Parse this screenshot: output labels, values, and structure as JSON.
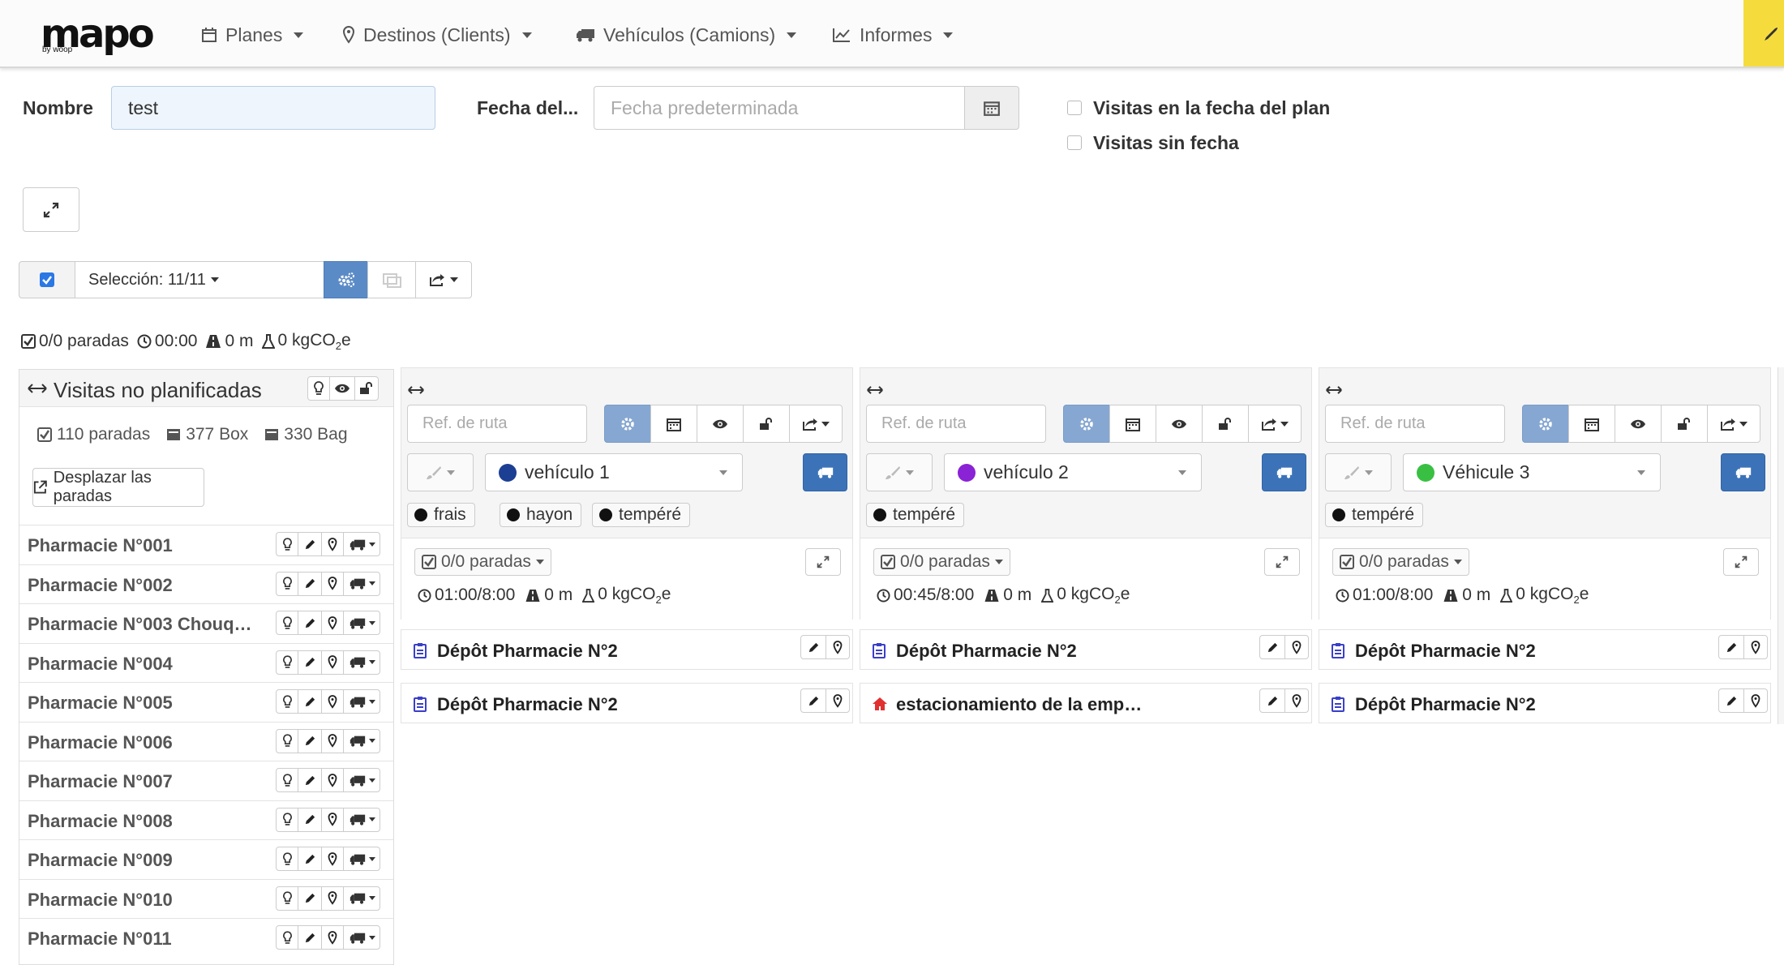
{
  "brand": {
    "name": "mapo",
    "tagline": "by woop"
  },
  "nav": {
    "planes": "Planes",
    "destinos": "Destinos (Clients)",
    "vehiculos": "Vehículos (Camions)",
    "informes": "Informes"
  },
  "form": {
    "nombre_label": "Nombre",
    "nombre_value": "test",
    "fecha_label": "Fecha del...",
    "fecha_placeholder": "Fecha predeterminada",
    "visitas_fecha_plan": "Visitas en la fecha del plan",
    "visitas_sin_fecha": "Visitas sin fecha"
  },
  "toolbar": {
    "seleccion": "Selección: 11/11"
  },
  "summary": {
    "paradas": "0/0 paradas",
    "tiempo": "00:00",
    "distancia": "0 m",
    "co2": "0 kgCO",
    "co2_sub": "2",
    "co2_suffix": "e"
  },
  "unplanned": {
    "title": "Visitas no planificadas",
    "paradas": "110 paradas",
    "box": "377 Box",
    "bag": "330 Bag",
    "move_button": "Desplazar las paradas",
    "items": [
      "Pharmacie N°001",
      "Pharmacie N°002",
      "Pharmacie N°003 Chouq…",
      "Pharmacie N°004",
      "Pharmacie N°005",
      "Pharmacie N°006",
      "Pharmacie N°007",
      "Pharmacie N°008",
      "Pharmacie N°009",
      "Pharmacie N°010",
      "Pharmacie N°011"
    ]
  },
  "routes": [
    {
      "ref_placeholder": "Ref. de ruta",
      "vehicle": "vehículo 1",
      "vehicle_color": "#1c3f94",
      "tags": [
        "frais",
        "hayon",
        "tempéré"
      ],
      "paradas": "0/0 paradas",
      "tiempo": "01:00/8:00",
      "distancia": "0 m",
      "co2": "0 kgCO",
      "co2_sub": "2",
      "co2_suffix": "e",
      "stops": [
        {
          "name": "Dépôt Pharmacie N°2",
          "icon": "store-icon",
          "icon_color": "#3a3fc9"
        },
        {
          "name": "Dépôt Pharmacie N°2",
          "icon": "store-icon",
          "icon_color": "#3a3fc9"
        }
      ]
    },
    {
      "ref_placeholder": "Ref. de ruta",
      "vehicle": "vehículo 2",
      "vehicle_color": "#8a22d6",
      "tags": [
        "tempéré"
      ],
      "paradas": "0/0 paradas",
      "tiempo": "00:45/8:00",
      "distancia": "0 m",
      "co2": "0 kgCO",
      "co2_sub": "2",
      "co2_suffix": "e",
      "stops": [
        {
          "name": "Dépôt Pharmacie N°2",
          "icon": "store-icon",
          "icon_color": "#3a3fc9"
        },
        {
          "name": "estacionamiento de la emp…",
          "icon": "home-icon",
          "icon_color": "#e03030"
        }
      ]
    },
    {
      "ref_placeholder": "Ref. de ruta",
      "vehicle": "Véhicule 3",
      "vehicle_color": "#39c043",
      "tags": [
        "tempéré"
      ],
      "paradas": "0/0 paradas",
      "tiempo": "01:00/8:00",
      "distancia": "0 m",
      "co2": "0 kgCO",
      "co2_sub": "2",
      "co2_suffix": "e",
      "stops": [
        {
          "name": "Dépôt Pharmacie N°2",
          "icon": "store-icon",
          "icon_color": "#3a3fc9"
        },
        {
          "name": "Dépôt Pharmacie N°2",
          "icon": "store-icon",
          "icon_color": "#3a3fc9"
        }
      ]
    }
  ],
  "colors": {
    "primary": "#5b8bc7",
    "accent_yellow": "#f5dc3c",
    "checkbox": "#2a78e4"
  }
}
